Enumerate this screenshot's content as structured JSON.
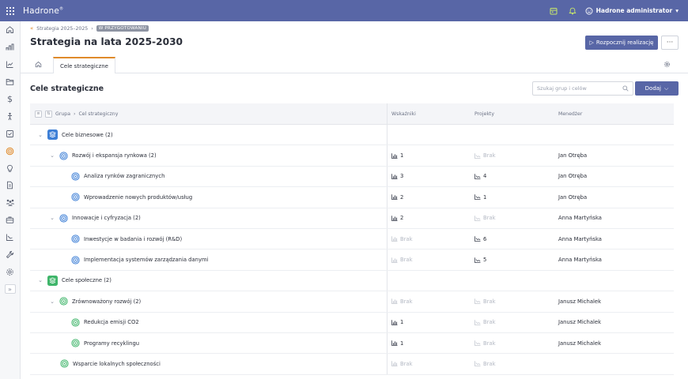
{
  "app": {
    "name": "Hadrone",
    "user": "Hadrone administrator"
  },
  "breadcrumb": {
    "parent": "Strategia 2025–2025",
    "separator": "›",
    "status": "W PRZYGOTOWANIU"
  },
  "page": {
    "title": "Strategia na lata 2025-2030",
    "start_label": "Rozpocznij realizację",
    "more_label": "···"
  },
  "tabs": {
    "active": "Cele strategiczne"
  },
  "section": {
    "title": "Cele strategiczne",
    "search_placeholder": "Szukaj grup i celów",
    "add_label": "Dodaj"
  },
  "table": {
    "headers": {
      "group": "Grupa",
      "goal": "Cel strategiczny",
      "indicators": "Wskaźniki",
      "projects": "Projekty",
      "manager": "Menedżer"
    },
    "rows": [
      {
        "type": "group",
        "name": "Cele biznesowe (2)",
        "color": "blue"
      },
      {
        "type": "goal",
        "level": 1,
        "name": "Rozwój i ekspansja rynkowa (2)",
        "color": "blue",
        "indicators": "1",
        "projects": "Brak",
        "manager": "Jan Otręba"
      },
      {
        "type": "goal",
        "level": 2,
        "name": "Analiza rynków zagranicznych",
        "color": "blue",
        "indicators": "3",
        "projects": "4",
        "manager": "Jan Otręba"
      },
      {
        "type": "goal",
        "level": 2,
        "name": "Wprowadzenie nowych produktów/usług",
        "color": "blue",
        "indicators": "2",
        "projects": "1",
        "manager": "Jan Otręba"
      },
      {
        "type": "goal",
        "level": 1,
        "name": "Innowacje i cyfryzacja (2)",
        "color": "blue",
        "indicators": "2",
        "projects": "Brak",
        "manager": "Anna Martyńska"
      },
      {
        "type": "goal",
        "level": 2,
        "name": "Inwestycje w badania i rozwój (R&D)",
        "color": "blue",
        "indicators": "Brak",
        "projects": "6",
        "manager": "Anna Martyńska"
      },
      {
        "type": "goal",
        "level": 2,
        "name": "Implementacja systemów zarządzania danymi",
        "color": "blue",
        "indicators": "Brak",
        "projects": "5",
        "manager": "Anna Martyńska"
      },
      {
        "type": "group",
        "name": "Cele społeczne (2)",
        "color": "green"
      },
      {
        "type": "goal",
        "level": 1,
        "name": "Zrównoważony rozwój (2)",
        "color": "green",
        "indicators": "Brak",
        "projects": "Brak",
        "manager": "Janusz Michalek"
      },
      {
        "type": "goal",
        "level": 2,
        "name": "Redukcja emisji CO2",
        "color": "green",
        "indicators": "1",
        "projects": "Brak",
        "manager": "Janusz Michalek"
      },
      {
        "type": "goal",
        "level": 2,
        "name": "Programy recyklingu",
        "color": "green",
        "indicators": "1",
        "projects": "Brak",
        "manager": "Janusz Michalek"
      },
      {
        "type": "goal",
        "level": 1,
        "leaf": true,
        "name": "Wsparcie lokalnych społeczności",
        "color": "green",
        "indicators": "Brak",
        "projects": "Brak",
        "manager": ""
      }
    ]
  },
  "colors": {
    "primary": "#5866a6",
    "accent": "#e08a2a",
    "blue": "#3d7fd6",
    "green": "#3fb56a"
  },
  "sidebar_icons": [
    "home-icon",
    "dashboard-icon",
    "chart-icon",
    "folder-icon",
    "dollar-icon",
    "person-icon",
    "checklist-icon",
    "target-icon",
    "lightbulb-icon",
    "document-icon",
    "team-icon",
    "briefcase-icon",
    "chart-line-icon",
    "wrench-icon",
    "settings-icon"
  ]
}
